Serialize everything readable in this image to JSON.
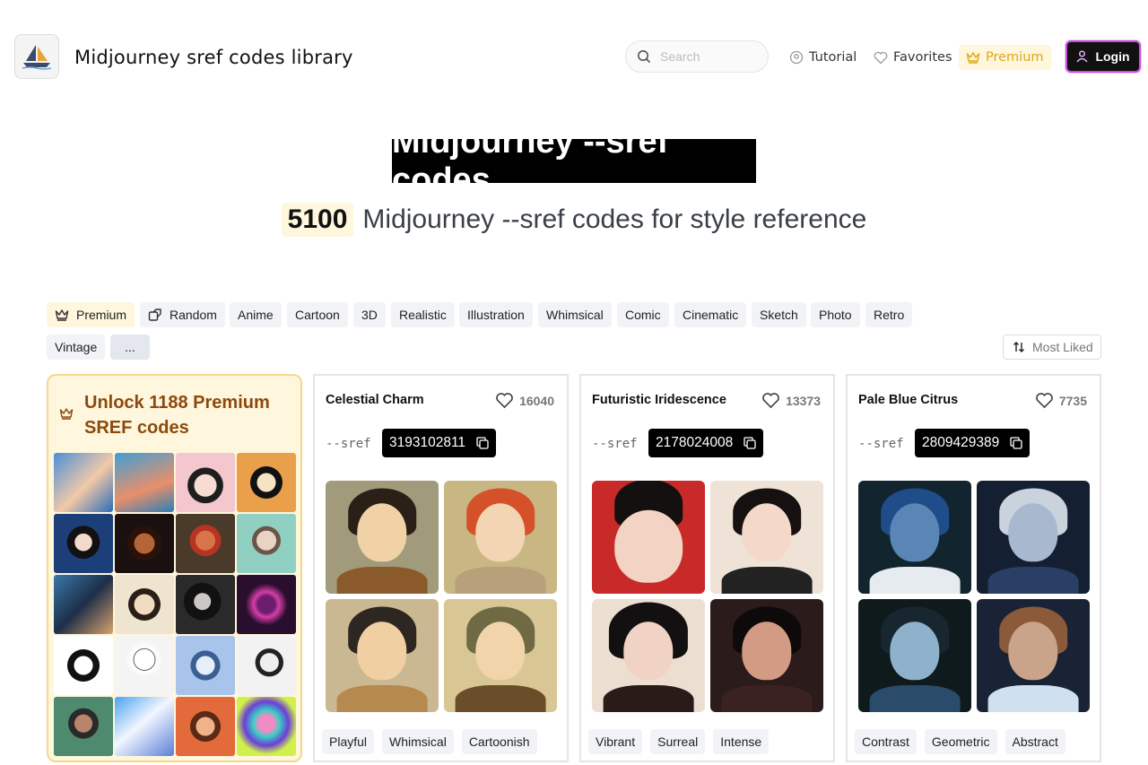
{
  "header": {
    "title": "Midjourney sref codes library",
    "search_placeholder": "Search",
    "nav": {
      "tutorial": "Tutorial",
      "favorites": "Favorites",
      "premium": "Premium",
      "login": "Login"
    }
  },
  "hero": {
    "title": "Midjourney --sref codes",
    "count": "5100",
    "subtitle": "Midjourney --sref codes for style reference"
  },
  "filters": {
    "tags": [
      "Premium",
      "Random",
      "Anime",
      "Cartoon",
      "3D",
      "Realistic",
      "Illustration",
      "Whimsical",
      "Comic",
      "Cinematic",
      "Sketch",
      "Photo",
      "Retro",
      "Vintage",
      "..."
    ],
    "sort": "Most Liked"
  },
  "premium_card": {
    "title": "Unlock 1188 Premium SREF codes"
  },
  "cards": [
    {
      "title": "Celestial Charm",
      "likes": "16040",
      "sref_label": "--sref",
      "code": "3193102811",
      "tags": [
        "Playful",
        "Whimsical",
        "Cartoonish"
      ]
    },
    {
      "title": "Futuristic Iridescence",
      "likes": "13373",
      "sref_label": "--sref",
      "code": "2178024008",
      "tags": [
        "Vibrant",
        "Surreal",
        "Intense"
      ]
    },
    {
      "title": "Pale Blue Citrus",
      "likes": "7735",
      "sref_label": "--sref",
      "code": "2809429389",
      "tags": [
        "Contrast",
        "Geometric",
        "Abstract"
      ]
    }
  ],
  "colors": {
    "accent": "#e2a614",
    "premium_bg": "#fef6dd",
    "premium_text": "#8c4a0e",
    "login_border": "#c94ee0"
  }
}
